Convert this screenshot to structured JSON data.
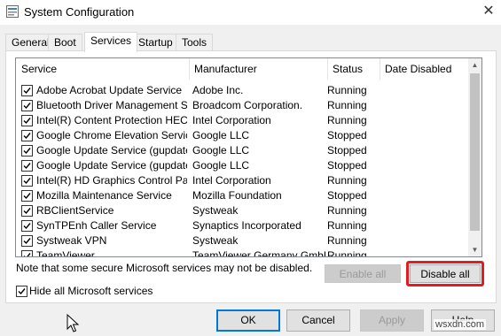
{
  "window": {
    "title": "System Configuration",
    "close_glyph": "✕"
  },
  "tabs": [
    {
      "label": "General"
    },
    {
      "label": "Boot"
    },
    {
      "label": "Services"
    },
    {
      "label": "Startup"
    },
    {
      "label": "Tools"
    }
  ],
  "active_tab": "Services",
  "table": {
    "columns": [
      "Service",
      "Manufacturer",
      "Status",
      "Date Disabled"
    ],
    "rows": [
      {
        "service": "Adobe Acrobat Update Service",
        "manufacturer": "Adobe Inc.",
        "status": "Running",
        "date_disabled": "",
        "checked": true
      },
      {
        "service": "Bluetooth Driver Management S...",
        "manufacturer": "Broadcom Corporation.",
        "status": "Running",
        "date_disabled": "",
        "checked": true
      },
      {
        "service": "Intel(R) Content Protection HEC...",
        "manufacturer": "Intel Corporation",
        "status": "Running",
        "date_disabled": "",
        "checked": true
      },
      {
        "service": "Google Chrome Elevation Service",
        "manufacturer": "Google LLC",
        "status": "Stopped",
        "date_disabled": "",
        "checked": true
      },
      {
        "service": "Google Update Service (gupdate)",
        "manufacturer": "Google LLC",
        "status": "Stopped",
        "date_disabled": "",
        "checked": true
      },
      {
        "service": "Google Update Service (gupdatem)",
        "manufacturer": "Google LLC",
        "status": "Stopped",
        "date_disabled": "",
        "checked": true
      },
      {
        "service": "Intel(R) HD Graphics Control Pa...",
        "manufacturer": "Intel Corporation",
        "status": "Running",
        "date_disabled": "",
        "checked": true
      },
      {
        "service": "Mozilla Maintenance Service",
        "manufacturer": "Mozilla Foundation",
        "status": "Stopped",
        "date_disabled": "",
        "checked": true
      },
      {
        "service": "RBClientService",
        "manufacturer": "Systweak",
        "status": "Running",
        "date_disabled": "",
        "checked": true
      },
      {
        "service": "SynTPEnh Caller Service",
        "manufacturer": "Synaptics Incorporated",
        "status": "Running",
        "date_disabled": "",
        "checked": true
      },
      {
        "service": "Systweak VPN",
        "manufacturer": "Systweak",
        "status": "Running",
        "date_disabled": "",
        "checked": true
      },
      {
        "service": "TeamViewer",
        "manufacturer": "TeamViewer Germany GmbH",
        "status": "Running",
        "date_disabled": "",
        "checked": true
      }
    ]
  },
  "note": "Note that some secure Microsoft services may not be disabled.",
  "buttons": {
    "enable_all": "Enable all",
    "disable_all": "Disable all"
  },
  "hide_ms": {
    "label": "Hide all Microsoft services",
    "checked": true
  },
  "footer": {
    "ok": "OK",
    "cancel": "Cancel",
    "apply": "Apply",
    "help": "Help"
  },
  "watermark": "wsxdn.com",
  "colors": {
    "highlight": "#e31b23",
    "primary_border": "#0078d7"
  },
  "icons": [
    "system-config-icon",
    "close-icon",
    "checkbox-checked-icon",
    "scroll-up-arrow-icon",
    "scroll-down-arrow-icon",
    "mouse-cursor-icon"
  ]
}
